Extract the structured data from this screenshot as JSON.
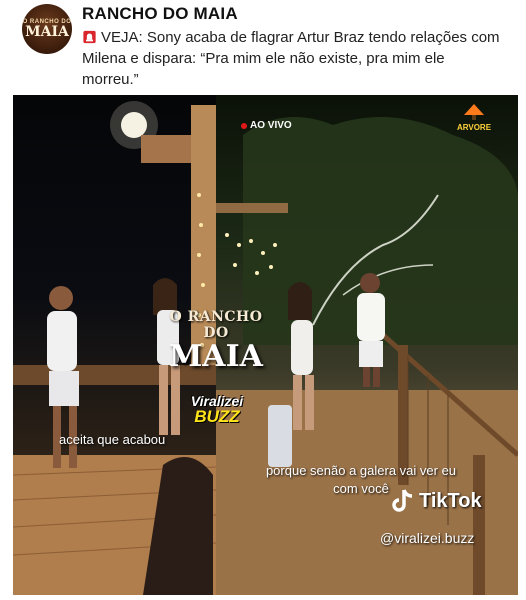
{
  "post": {
    "author": "RANCHO DO MAIA",
    "avatar_text_top": "O RANCHO DO",
    "avatar_text_main": "MAIA",
    "text_prefix": "VEJA: ",
    "text_body": "Sony acaba de flagrar Artur Braz tendo relações com Milena e dispara: “Pra mim ele não existe, pra mim ele morreu.”",
    "icon": "siren-icon"
  },
  "video": {
    "live_label": "AO VIVO",
    "corner_logo": "ARVORE",
    "center_logo_top": "O RANCHO DO",
    "center_logo_main": "MAIA",
    "watermark_top": "Viralizei",
    "watermark_bottom": "BUZZ",
    "subtitle_left": "aceita que acabou",
    "subtitle_right": "porque senão a galera vai ver eu com você",
    "tiktok_label": "TikTok",
    "tiktok_handle": "@viralizei.buzz"
  },
  "colors": {
    "accent_live": "#e01818",
    "watermark_yellow": "#ffe51a",
    "subtitle_text": "#ffffff"
  }
}
